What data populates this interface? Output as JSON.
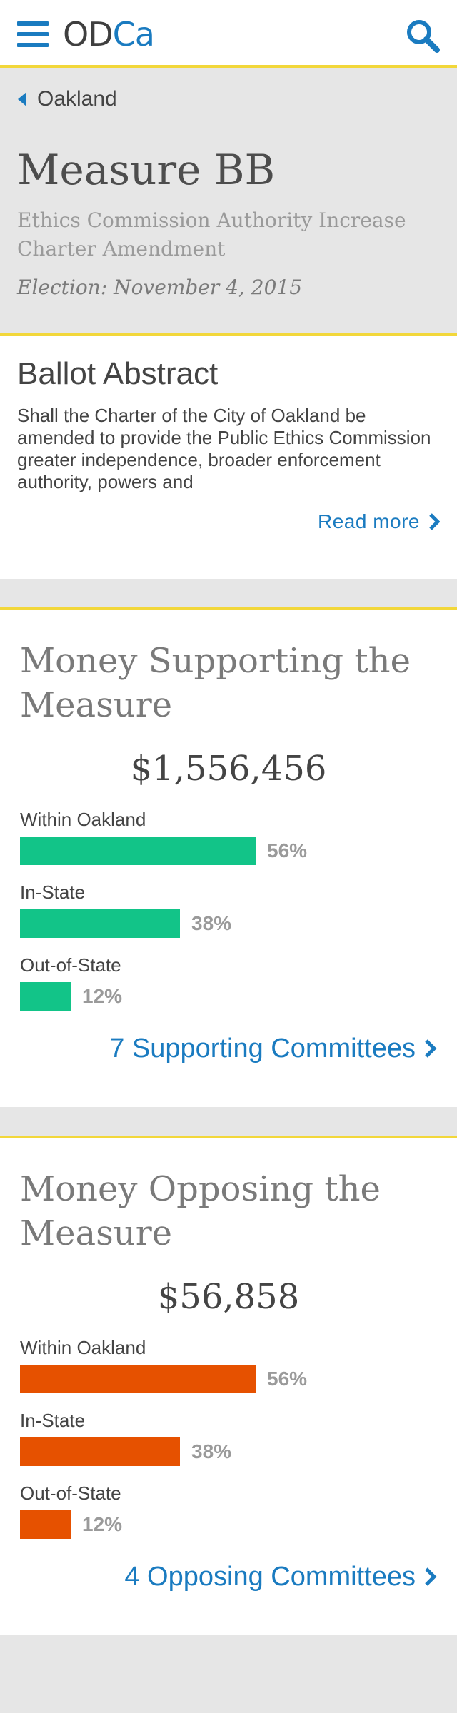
{
  "header": {
    "logo_part1": "OD",
    "logo_part2": "Ca",
    "menu_icon": "hamburger-menu-icon",
    "search_icon": "search-icon",
    "accent_color": "#1a7bc0",
    "border_color": "#f2d73a"
  },
  "hero": {
    "back_label": "Oakland",
    "title": "Measure BB",
    "subtitle": "Ethics Commission Authority Increase Charter Amendment",
    "election": "Election: November 4, 2015"
  },
  "abstract": {
    "heading": "Ballot Abstract",
    "text": "Shall the Charter of the City of Oakland be amended to provide the Public Ethics Commission greater independence, broader enforcement authority, powers and",
    "read_more": "Read more"
  },
  "supporting": {
    "heading": "Money Supporting the Measure",
    "total": "$1,556,456",
    "bar_color": "#12c488",
    "rows": [
      {
        "label": "Within Oakland",
        "percent_text": "56%",
        "fraction": 0.56
      },
      {
        "label": "In-State",
        "percent_text": "38%",
        "fraction": 0.38
      },
      {
        "label": "Out-of-State",
        "percent_text": "12%",
        "fraction": 0.12
      }
    ],
    "committees_link": "7 Supporting Committees"
  },
  "opposing": {
    "heading": "Money Opposing the Measure",
    "total": "$56,858",
    "bar_color": "#e65100",
    "rows": [
      {
        "label": "Within Oakland",
        "percent_text": "56%",
        "fraction": 0.56
      },
      {
        "label": "In-State",
        "percent_text": "38%",
        "fraction": 0.38
      },
      {
        "label": "Out-of-State",
        "percent_text": "12%",
        "fraction": 0.12
      }
    ],
    "committees_link": "4 Opposing Committees"
  }
}
